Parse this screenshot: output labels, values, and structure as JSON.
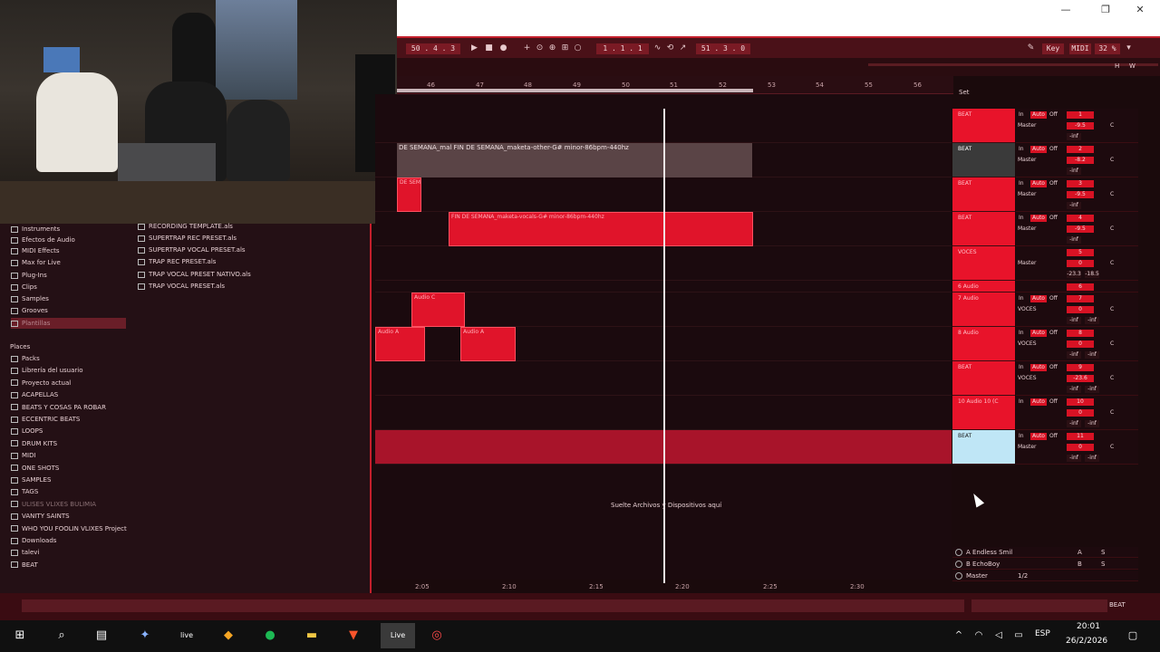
{
  "window": {
    "minimize": "—",
    "restore": "❐",
    "close": "✕"
  },
  "transport": {
    "position": "50 . 4 . 3",
    "loop_start": "1 . 1 . 1",
    "loop_length": "51 . 3 . 0",
    "key": "Key",
    "midi": "MIDI",
    "cpu": "32 %"
  },
  "ruler": {
    "bars": [
      "46",
      "47",
      "48",
      "49",
      "50",
      "51",
      "52",
      "53",
      "54",
      "55",
      "56"
    ]
  },
  "time_ruler": {
    "ticks": [
      "2:05",
      "2:10",
      "2:15",
      "2:20",
      "2:25",
      "2:30"
    ]
  },
  "set_label": "Set",
  "browser": {
    "categories": [
      {
        "label": "Instruments",
        "icon": "instrument-icon"
      },
      {
        "label": "Efectos de Audio",
        "icon": "audio-effect-icon"
      },
      {
        "label": "MIDI Effects",
        "icon": "midi-effect-icon"
      },
      {
        "label": "Max for Live",
        "icon": "max-icon"
      },
      {
        "label": "Plug-Ins",
        "icon": "plugin-icon"
      },
      {
        "label": "Clips",
        "icon": "clip-icon"
      },
      {
        "label": "Samples",
        "icon": "sample-icon"
      },
      {
        "label": "Grooves",
        "icon": "groove-icon"
      },
      {
        "label": "Plantillas",
        "icon": "template-icon"
      }
    ],
    "places_title": "Places",
    "places": [
      "Packs",
      "Librería del usuario",
      "Proyecto actual",
      "ACAPELLAS",
      "BEATS Y COSAS PA ROBAR",
      "ECCENTRIC BEATS",
      "LOOPS",
      "DRUM KITS",
      "MIDI",
      "ONE SHOTS",
      "SAMPLES",
      "TAGS",
      "ULISES VLIXES BULIMIA",
      "VANITY SAINTS",
      "WHO YOU FOOLIN VLIXES Project",
      "Downloads",
      "talevi",
      "BEAT"
    ],
    "files": [
      "RECORDING TEMPLATE.als",
      "SUPERTRAP REC PRESET.als",
      "SUPERTRAP VOCAL PRESET.als",
      "TRAP REC PRESET.als",
      "TRAP VOCAL PRESET NATIVO.als",
      "TRAP VOCAL PRESET.als"
    ]
  },
  "clips": {
    "fin_semana": "DE SEMANA_mal FIN DE SEMANA_maketa-other-G# minor-86bpm-440hz",
    "vocals": "FIN DE SEMANA_maketa-vocals-G# minor-86bpm-440hz",
    "de_sem": "DE SEM",
    "audio_a1": "Audio A",
    "audio_a2": "Audio A",
    "audio_c": "Audio C"
  },
  "drop_hint": "Suelte Archivos y Dispositivos aquí",
  "tracks": [
    {
      "name": "BEAT",
      "in": "In",
      "mode": "Auto",
      "off": "Off",
      "route": "Master",
      "vol": "-9.5",
      "pan": "C",
      "num": "1",
      "peak": "-inf",
      "peak2": ""
    },
    {
      "name": "BEAT",
      "in": "In",
      "mode": "Auto",
      "off": "Off",
      "route": "Master",
      "vol": "-8.2",
      "pan": "C",
      "num": "2",
      "peak": "-inf",
      "peak2": ""
    },
    {
      "name": "BEAT",
      "in": "In",
      "mode": "Auto",
      "off": "Off",
      "route": "Master",
      "vol": "-9.5",
      "pan": "C",
      "num": "3",
      "peak": "-inf",
      "peak2": ""
    },
    {
      "name": "BEAT",
      "in": "In",
      "mode": "Auto",
      "off": "Off",
      "route": "Master",
      "vol": "-9.5",
      "pan": "C",
      "num": "4",
      "peak": "-inf",
      "peak2": ""
    },
    {
      "name": "VOCES",
      "in": "",
      "mode": "",
      "off": "",
      "route": "Master",
      "vol": "0",
      "pan": "C",
      "num": "5",
      "peak": "-23.3",
      "peak2": "-18.5"
    },
    {
      "name": "6 Audio",
      "in": "",
      "mode": "",
      "off": "",
      "route": "",
      "vol": "",
      "pan": "",
      "num": "6",
      "peak": "",
      "peak2": ""
    },
    {
      "name": "7 Audio",
      "in": "In",
      "mode": "Auto",
      "off": "Off",
      "route": "VOCES",
      "vol": "0",
      "pan": "C",
      "num": "7",
      "peak": "-inf",
      "peak2": "-inf"
    },
    {
      "name": "8 Audio",
      "in": "In",
      "mode": "Auto",
      "off": "Off",
      "route": "VOCES",
      "vol": "0",
      "pan": "C",
      "num": "8",
      "peak": "-inf",
      "peak2": "-inf"
    },
    {
      "name": "BEAT",
      "in": "In",
      "mode": "Auto",
      "off": "Off",
      "route": "VOCES",
      "vol": "-23.6",
      "pan": "C",
      "num": "9",
      "peak": "-inf",
      "peak2": "-inf"
    },
    {
      "name": "10 Audio 10 (C",
      "in": "In",
      "mode": "Auto",
      "off": "Off",
      "route": "",
      "vol": "0",
      "pan": "C",
      "num": "10",
      "peak": "-inf",
      "peak2": "-inf"
    },
    {
      "name": "BEAT",
      "in": "In",
      "mode": "Auto",
      "off": "Off",
      "route": "Master",
      "vol": "0",
      "pan": "C",
      "num": "11",
      "peak": "-inf",
      "peak2": "-inf"
    }
  ],
  "returns": [
    {
      "name": "A Endless Smil",
      "letter": "A",
      "s": "S"
    },
    {
      "name": "B EchoBoy",
      "letter": "B",
      "s": "S"
    },
    {
      "name": "Master",
      "letter": "1/2",
      "s": ""
    }
  ],
  "bottom_track": "BEAT",
  "taskbar": {
    "lang": "ESP",
    "time": "20:01",
    "date": "26/2/2026",
    "live1": "live",
    "live2": "Live"
  }
}
